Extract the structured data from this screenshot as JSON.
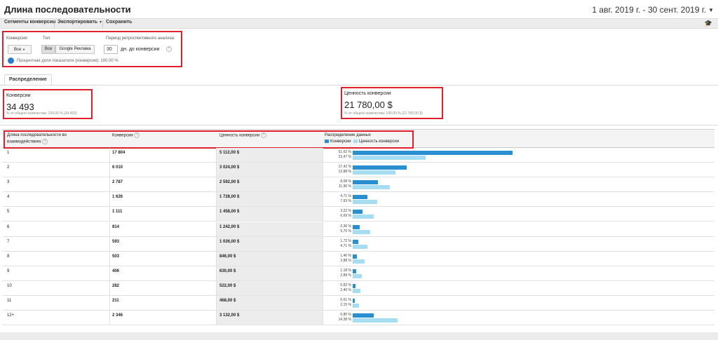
{
  "header": {
    "title": "Длина последовательности",
    "date_range": "1 авг. 2019 г. - 30 сент. 2019 г."
  },
  "toolbar": {
    "segments": "Сегменты конверсии",
    "export": "Экспортировать",
    "save": "Сохранить",
    "icon": "graduation-cap-icon"
  },
  "filters": {
    "conversion_label": "Конверсия:",
    "conversion_value": "Все",
    "type_label": "Тип:",
    "type_all": "Все",
    "type_ads": "Google Реклама",
    "lookback_label": "Период ретроспективного анализа:",
    "lookback_value": "30",
    "lookback_unit": "дн. до конверсии",
    "share_text": "Процентная доля показателя (конверсии): 100,00 %"
  },
  "tabs": {
    "distribution": "Распределение"
  },
  "metrics": {
    "conversions": {
      "label": "Конверсии",
      "value": "34 493",
      "sub": "% от общего количества: 100,00 % (34 493)"
    },
    "value": {
      "label": "Ценность конверсии",
      "value": "21 780,00 $",
      "sub": "% от общего количества: 100,00 % (21 780,00 $)"
    }
  },
  "table": {
    "headers": {
      "path_length": "Длина последовательности во взаимодействиях",
      "conversions": "Конверсии",
      "value": "Ценность конверсии",
      "distribution": "Распределение данных",
      "legend_conversions": "Конверсии",
      "legend_value": "Ценность конверсии"
    },
    "colors": {
      "conversions": "#2a8fd0",
      "value": "#a6ddf2"
    },
    "rows": [
      {
        "length": "1",
        "conversions": "17 804",
        "value": "5 112,00 $",
        "conv_pct": "51,62 %",
        "value_pct": "23,47 %",
        "conv_share": 51.62,
        "value_share": 23.47
      },
      {
        "length": "2",
        "conversions": "6 010",
        "value": "3 024,00 $",
        "conv_pct": "17,42 %",
        "value_pct": "13,88 %",
        "conv_share": 17.42,
        "value_share": 13.88
      },
      {
        "length": "3",
        "conversions": "2 787",
        "value": "2 592,00 $",
        "conv_pct": "8,08 %",
        "value_pct": "11,90 %",
        "conv_share": 8.08,
        "value_share": 11.9
      },
      {
        "length": "4",
        "conversions": "1 626",
        "value": "1 728,00 $",
        "conv_pct": "4,71 %",
        "value_pct": "7,93 %",
        "conv_share": 4.71,
        "value_share": 7.93
      },
      {
        "length": "5",
        "conversions": "1 111",
        "value": "1 458,00 $",
        "conv_pct": "3,22 %",
        "value_pct": "6,69 %",
        "conv_share": 3.22,
        "value_share": 6.69
      },
      {
        "length": "6",
        "conversions": "814",
        "value": "1 242,00 $",
        "conv_pct": "2,36 %",
        "value_pct": "5,70 %",
        "conv_share": 2.36,
        "value_share": 5.7
      },
      {
        "length": "7",
        "conversions": "593",
        "value": "1 026,00 $",
        "conv_pct": "1,72 %",
        "value_pct": "4,71 %",
        "conv_share": 1.72,
        "value_share": 4.71
      },
      {
        "length": "8",
        "conversions": "503",
        "value": "846,00 $",
        "conv_pct": "1,46 %",
        "value_pct": "3,88 %",
        "conv_share": 1.46,
        "value_share": 3.88
      },
      {
        "length": "9",
        "conversions": "406",
        "value": "630,00 $",
        "conv_pct": "1,18 %",
        "value_pct": "2,89 %",
        "conv_share": 1.18,
        "value_share": 2.89
      },
      {
        "length": "10",
        "conversions": "282",
        "value": "522,00 $",
        "conv_pct": "0,82 %",
        "value_pct": "2,40 %",
        "conv_share": 0.82,
        "value_share": 2.4
      },
      {
        "length": "11",
        "conversions": "211",
        "value": "468,00 $",
        "conv_pct": "0,61 %",
        "value_pct": "2,15 %",
        "conv_share": 0.61,
        "value_share": 2.15
      },
      {
        "length": "12+",
        "conversions": "2 346",
        "value": "3 132,00 $",
        "conv_pct": "6,80 %",
        "value_pct": "14,38 %",
        "conv_share": 6.8,
        "value_share": 14.38
      }
    ]
  }
}
